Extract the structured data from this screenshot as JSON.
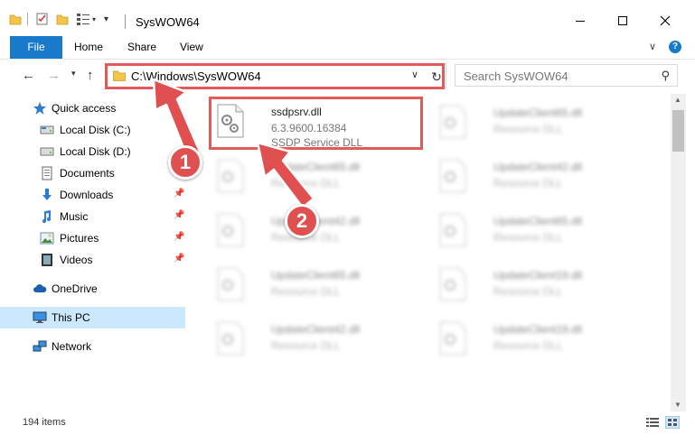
{
  "window": {
    "title": "SysWOW64"
  },
  "ribbon": {
    "file": "File",
    "home": "Home",
    "share": "Share",
    "view": "View",
    "help": "?"
  },
  "address": {
    "path": "C:\\Windows\\SysWOW64"
  },
  "search": {
    "placeholder": "Search SysWOW64"
  },
  "sidebar": {
    "items": [
      {
        "label": "Quick access",
        "icon": "star-icon",
        "pinned": false
      },
      {
        "label": "Local Disk (C:)",
        "icon": "disk-icon",
        "pinned": false
      },
      {
        "label": "Local Disk (D:)",
        "icon": "disk-icon",
        "pinned": false
      },
      {
        "label": "Documents",
        "icon": "documents-icon",
        "pinned": false
      },
      {
        "label": "Downloads",
        "icon": "download-icon",
        "pinned": true
      },
      {
        "label": "Music",
        "icon": "music-icon",
        "pinned": true
      },
      {
        "label": "Pictures",
        "icon": "pictures-icon",
        "pinned": true
      },
      {
        "label": "Videos",
        "icon": "videos-icon",
        "pinned": true
      },
      {
        "label": "OneDrive",
        "icon": "cloud-icon",
        "pinned": false
      },
      {
        "label": "This PC",
        "icon": "computer-icon",
        "pinned": false,
        "selected": true
      },
      {
        "label": "Network",
        "icon": "network-icon",
        "pinned": false
      }
    ]
  },
  "files": {
    "highlighted": {
      "name": "ssdpsrv.dll",
      "version": "6.3.9600.16384",
      "description": "SSDP Service DLL"
    },
    "left_column": [
      {
        "name": "UpdateClient65.dll",
        "type": "Resource DLL"
      },
      {
        "name": "UpdateClient42.dll",
        "type": "Resource DLL"
      },
      {
        "name": "UpdateClient65.dll",
        "type": "Resource DLL"
      },
      {
        "name": "UpdateClient42.dll",
        "type": "Resource DLL"
      }
    ],
    "right_column": [
      {
        "name": "UpdateClient65.dll",
        "type": "Resource DLL"
      },
      {
        "name": "UpdateClient42.dll",
        "type": "Resource DLL"
      },
      {
        "name": "UpdateClient65.dll",
        "type": "Resource DLL"
      },
      {
        "name": "UpdateClient19.dll",
        "type": "Resource DLL"
      },
      {
        "name": "UpdateClient19.dll",
        "type": "Resource DLL"
      }
    ]
  },
  "status": {
    "items": "194 items"
  },
  "callouts": {
    "one": "1",
    "two": "2"
  },
  "colors": {
    "accent": "#1979ca",
    "highlight": "#e25a5a",
    "selected": "#cce8ff",
    "folder": "#f3c54b"
  }
}
